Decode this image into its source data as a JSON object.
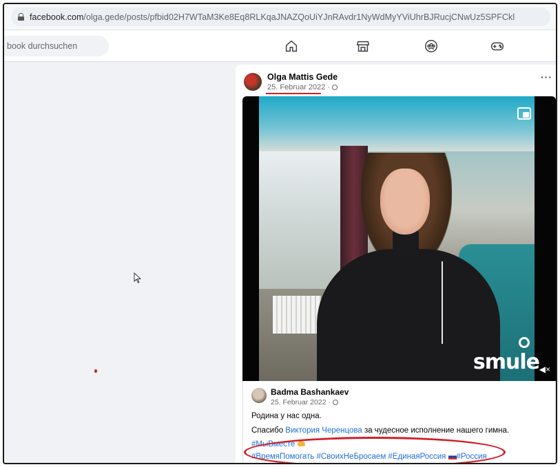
{
  "browser": {
    "url_host": "facebook.com",
    "url_path": "/olga.gede/posts/pfbid02H7WTaM3Ke8Eq8RLKqaJNAZQoUiYJnRAvdr1NyWdMyYViUhrBJRucjCNwUz5SPFCkl"
  },
  "fbnav": {
    "search_placeholder": "book durchsuchen",
    "icons": [
      "home-icon",
      "marketplace-icon",
      "groups-icon",
      "gaming-icon"
    ]
  },
  "post": {
    "author": "Olga Mattis Gede",
    "date": "25. Februar 2022 · ",
    "more": "···",
    "video": {
      "watermark": "smule",
      "mute_icon": "speaker-mute-icon"
    },
    "shared": {
      "author": "Badma Bashankaev",
      "date": "25. Februar 2022 · ",
      "line1": "Родина у нас одна.",
      "line2_prefix": "Спасибо ",
      "line2_link": "Виктория Черенцова",
      "line2_suffix": " за чудесное исполнение нашего гимна.",
      "tags1": "#МыВместе",
      "tags2_a": "#ВремяПомогать #СвоихНеБросаем #ЕдинаяРоссия ",
      "tags2_b": "#Россия"
    }
  },
  "colors": {
    "annotation_red": "#d0202a",
    "link_blue": "#216fdb"
  }
}
